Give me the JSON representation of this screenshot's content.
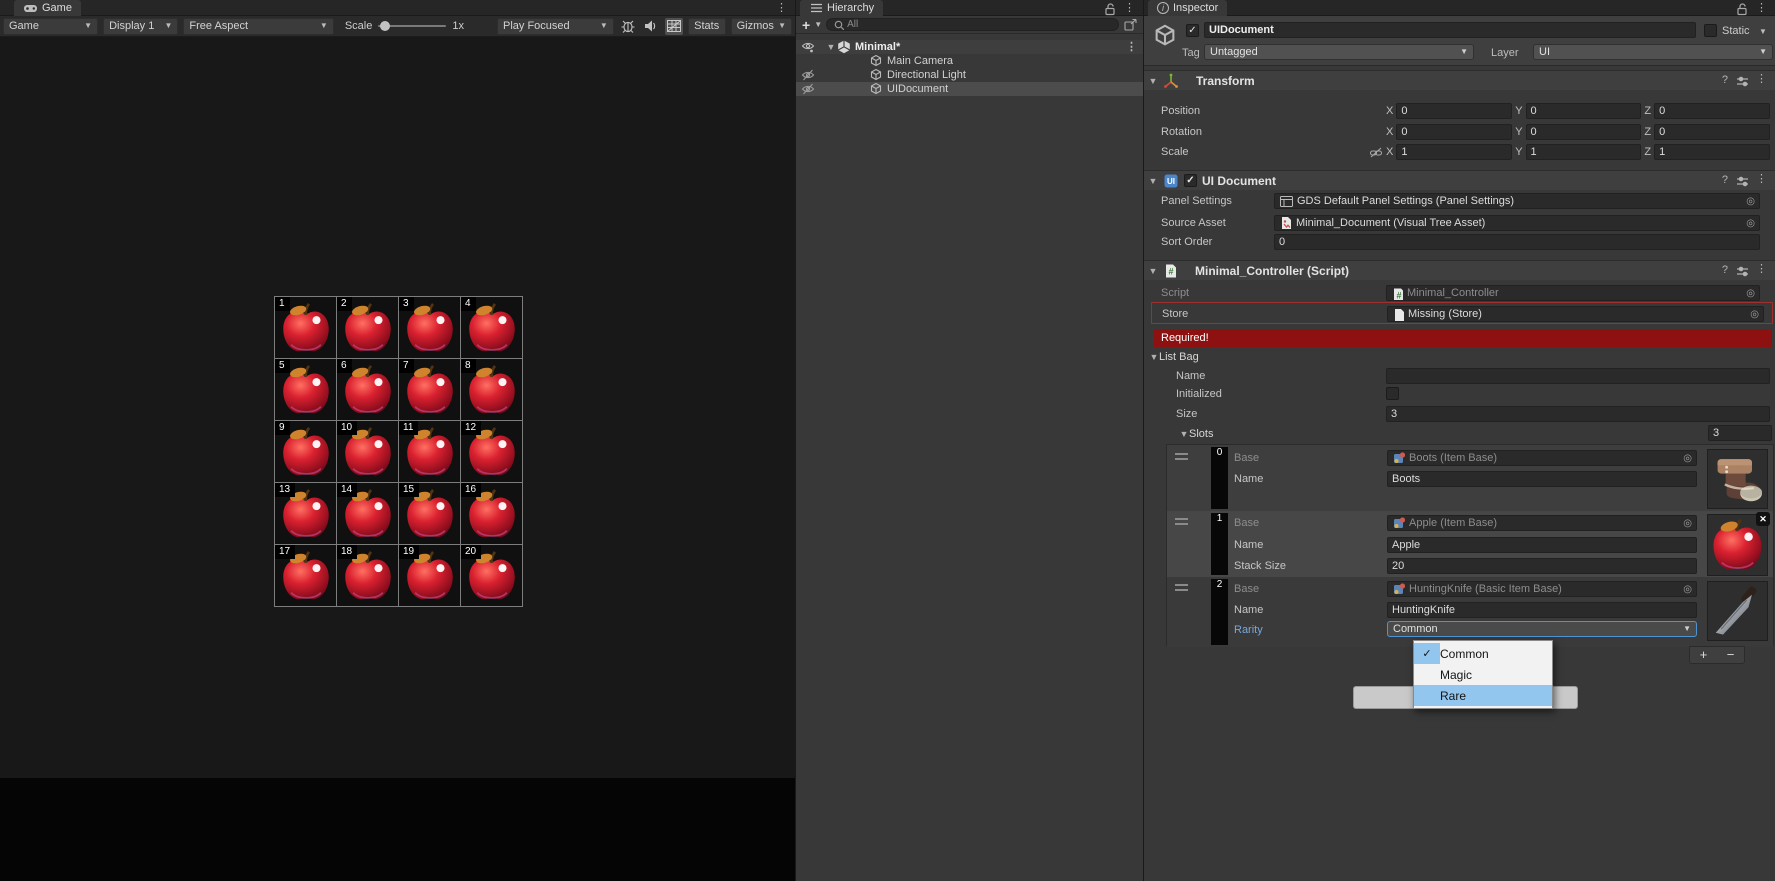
{
  "game_panel": {
    "tab_label": "Game",
    "toolbar": {
      "game": "Game",
      "display": "Display 1",
      "aspect": "Free Aspect",
      "scale_label": "Scale",
      "scale_value": "1x",
      "play_focused": "Play Focused",
      "stats": "Stats",
      "gizmos": "Gizmos"
    },
    "grid_cells": [
      "1",
      "2",
      "3",
      "4",
      "5",
      "6",
      "7",
      "8",
      "9",
      "10",
      "11",
      "12",
      "13",
      "14",
      "15",
      "16",
      "17",
      "18",
      "19",
      "20"
    ]
  },
  "hierarchy": {
    "tab_label": "Hierarchy",
    "search_value": "All",
    "scene_name": "Minimal*",
    "items": [
      {
        "label": "Main Camera",
        "hidden": false,
        "selected": false
      },
      {
        "label": "Directional Light",
        "hidden": true,
        "selected": false
      },
      {
        "label": "UIDocument",
        "hidden": true,
        "selected": true
      }
    ]
  },
  "inspector": {
    "tab_label": "Inspector",
    "header": {
      "name": "UIDocument",
      "static_label": "Static",
      "tag_label": "Tag",
      "tag_value": "Untagged",
      "layer_label": "Layer",
      "layer_value": "UI"
    },
    "transform": {
      "title": "Transform",
      "axis_labels": [
        "X",
        "Y",
        "Z"
      ],
      "rows": [
        {
          "label": "Position",
          "x": "0",
          "y": "0",
          "z": "0"
        },
        {
          "label": "Rotation",
          "x": "0",
          "y": "0",
          "z": "0"
        },
        {
          "label": "Scale",
          "x": "1",
          "y": "1",
          "z": "1"
        }
      ]
    },
    "ui_document": {
      "title": "UI Document",
      "panel_settings_label": "Panel Settings",
      "panel_settings_value": "GDS Default Panel Settings (Panel Settings)",
      "source_asset_label": "Source Asset",
      "source_asset_value": "Minimal_Document (Visual Tree Asset)",
      "sort_order_label": "Sort Order",
      "sort_order_value": "0"
    },
    "controller": {
      "title": "Minimal_Controller (Script)",
      "script_label": "Script",
      "script_value": "Minimal_Controller",
      "store_label": "Store",
      "store_value": "Missing (Store)",
      "required_text": "Required!",
      "list_bag": {
        "title": "List Bag",
        "name_label": "Name",
        "name_value": "",
        "initialized_label": "Initialized",
        "size_label": "Size",
        "size_value": "3",
        "slots_label": "Slots",
        "slots_count": "3",
        "slots": [
          {
            "index": "0",
            "base_label": "Base",
            "base_value": "Boots (Item Base)",
            "name_label": "Name",
            "name_value": "Boots",
            "preview": "boots"
          },
          {
            "index": "1",
            "base_label": "Base",
            "base_value": "Apple (Item Base)",
            "name_label": "Name",
            "name_value": "Apple",
            "stack_label": "Stack Size",
            "stack_value": "20",
            "preview": "apple"
          },
          {
            "index": "2",
            "base_label": "Base",
            "base_value": "HuntingKnife (Basic Item Base)",
            "name_label": "Name",
            "name_value": "HuntingKnife",
            "rarity_label": "Rarity",
            "rarity_value": "Common",
            "preview": "knife"
          }
        ]
      }
    },
    "rarity_dropdown": {
      "options": [
        {
          "label": "Common",
          "checked": true,
          "highlighted": false
        },
        {
          "label": "Magic",
          "checked": false,
          "highlighted": false
        },
        {
          "label": "Rare",
          "checked": false,
          "highlighted": true
        }
      ]
    },
    "colors": {
      "selection_blue": "#92c6ee",
      "error_red": "#8e1111",
      "override_blue": "#74a9dd",
      "focus_border": "#4f93d2"
    }
  }
}
